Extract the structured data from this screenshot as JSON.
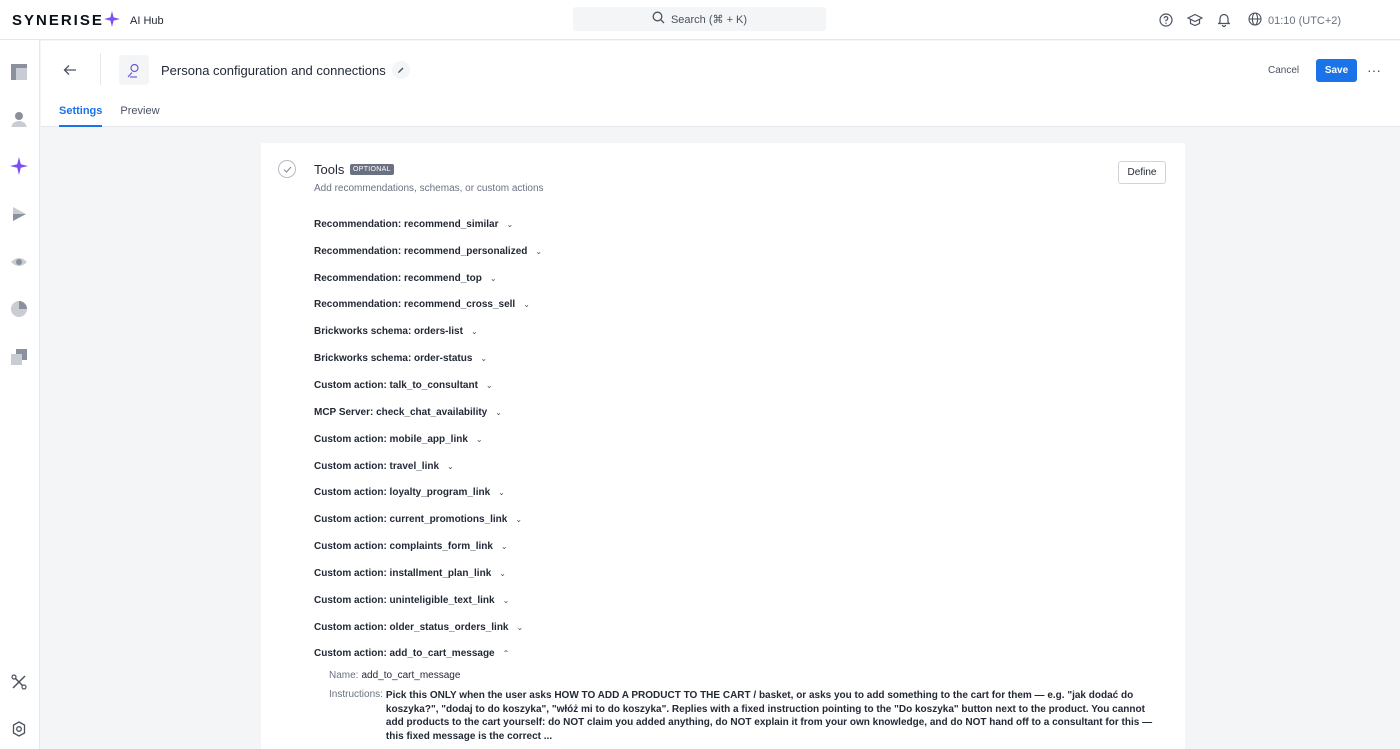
{
  "topbar": {
    "logo": "SYNERISE",
    "app_name": "AI Hub",
    "search_placeholder": "Search (⌘ + K)",
    "time": "01:10 (UTC+2)"
  },
  "header": {
    "title": "Persona configuration and connections",
    "cancel_label": "Cancel",
    "save_label": "Save",
    "more_label": "···",
    "tabs": [
      "Settings",
      "Preview"
    ]
  },
  "tools": {
    "title": "Tools",
    "badge": "OPTIONAL",
    "description": "Add recommendations, schemas, or custom actions",
    "define_label": "Define",
    "items": [
      "Recommendation: recommend_similar",
      "Recommendation: recommend_personalized",
      "Recommendation: recommend_top",
      "Recommendation: recommend_cross_sell",
      "Brickworks schema: orders-list",
      "Brickworks schema: order-status",
      "Custom action: talk_to_consultant",
      "MCP Server: check_chat_availability",
      "Custom action: mobile_app_link",
      "Custom action: travel_link",
      "Custom action: loyalty_program_link",
      "Custom action: current_promotions_link",
      "Custom action: complaints_form_link",
      "Custom action: installment_plan_link",
      "Custom action: uninteligible_text_link",
      "Custom action: older_status_orders_link",
      "Custom action: add_to_cart_message"
    ],
    "expanded": {
      "name_label": "Name:",
      "name_value": "add_to_cart_message",
      "instructions_label": "Instructions:",
      "instructions_value": "Pick this ONLY when the user asks HOW TO ADD A PRODUCT TO THE CART / basket, or asks you to add something to the cart for them — e.g. \"jak dodać do koszyka?\", \"dodaj to do koszyka\", \"włóż mi to do koszyka\". Replies with a fixed instruction pointing to the \"Do koszyka\" button next to the product. You cannot add products to the cart yourself: do NOT claim you added anything, do NOT explain it from your own knowledge, and do NOT hand off to a consultant for this — this fixed message is the correct ..."
    }
  },
  "colors": {
    "accent": "#1a73e8",
    "brand_purple": "#7b4ff0"
  }
}
